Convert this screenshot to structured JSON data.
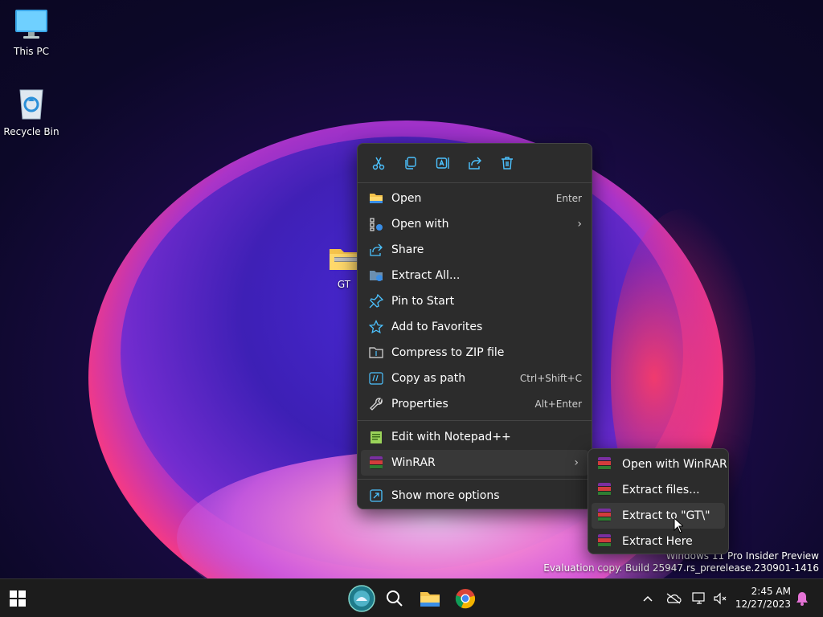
{
  "desktop": {
    "icons": [
      {
        "label": "This PC",
        "icon": "monitor-icon"
      },
      {
        "label": "Recycle Bin",
        "icon": "recycle-bin-icon"
      },
      {
        "label": "GT",
        "icon": "zip-folder-icon"
      }
    ],
    "watermark": {
      "line1": "Windows 11 Pro Insider Preview",
      "line2": "Evaluation copy. Build 25947.rs_prerelease.230901-1416"
    }
  },
  "context_menu": {
    "quick_actions": [
      {
        "name": "cut",
        "icon": "scissors-icon"
      },
      {
        "name": "copy",
        "icon": "copy-icon"
      },
      {
        "name": "rename",
        "icon": "rename-icon"
      },
      {
        "name": "share",
        "icon": "share-icon"
      },
      {
        "name": "delete",
        "icon": "trash-icon"
      }
    ],
    "items": [
      {
        "label": "Open",
        "shortcut": "Enter",
        "icon": "folder-icon"
      },
      {
        "label": "Open with",
        "shortcut": "",
        "icon": "open-with-icon",
        "submenu": true
      },
      {
        "label": "Share",
        "shortcut": "",
        "icon": "share-icon"
      },
      {
        "label": "Extract All...",
        "shortcut": "",
        "icon": "extract-icon"
      },
      {
        "label": "Pin to Start",
        "shortcut": "",
        "icon": "pin-icon"
      },
      {
        "label": "Add to Favorites",
        "shortcut": "",
        "icon": "star-icon"
      },
      {
        "label": "Compress to ZIP file",
        "shortcut": "",
        "icon": "zip-icon"
      },
      {
        "label": "Copy as path",
        "shortcut": "Ctrl+Shift+C",
        "icon": "path-icon"
      },
      {
        "label": "Properties",
        "shortcut": "Alt+Enter",
        "icon": "wrench-icon"
      }
    ],
    "items2": [
      {
        "label": "Edit with Notepad++",
        "icon": "notepadpp-icon"
      },
      {
        "label": "WinRAR",
        "icon": "winrar-icon",
        "submenu": true
      }
    ],
    "more": {
      "label": "Show more options",
      "icon": "more-options-icon"
    }
  },
  "winrar_submenu": {
    "items": [
      {
        "label": "Open with WinRAR"
      },
      {
        "label": "Extract files..."
      },
      {
        "label": "Extract to \"GT\\\""
      },
      {
        "label": "Extract Here"
      }
    ]
  },
  "taskbar": {
    "clock_time": "2:45 AM",
    "clock_date": "12/27/2023"
  },
  "colors": {
    "menu_bg": "#2c2c2c",
    "accent": "#4cc2ff"
  }
}
